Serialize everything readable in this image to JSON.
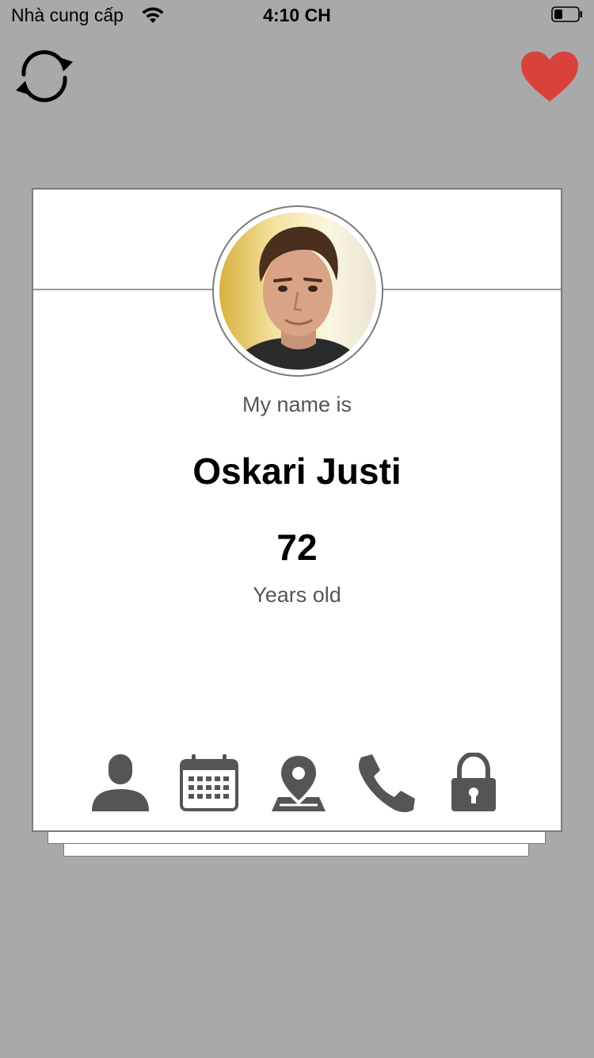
{
  "status_bar": {
    "carrier": "Nhà cung cấp",
    "time": "4:10 CH",
    "wifi_icon": "wifi-icon",
    "battery_icon": "battery-icon"
  },
  "toolbar": {
    "refresh_icon": "refresh-icon",
    "favorite_icon": "heart-icon",
    "favorite_color": "#d9413c"
  },
  "profile": {
    "subtitle": "My name is",
    "name": "Oskari Justi",
    "age": "72",
    "age_label": "Years old"
  },
  "tabs": [
    {
      "icon": "user-icon"
    },
    {
      "icon": "calendar-icon"
    },
    {
      "icon": "map-pin-icon"
    },
    {
      "icon": "phone-icon"
    },
    {
      "icon": "lock-icon"
    }
  ],
  "colors": {
    "background": "#a9a9a9",
    "icon": "#555555",
    "card": "#ffffff"
  }
}
